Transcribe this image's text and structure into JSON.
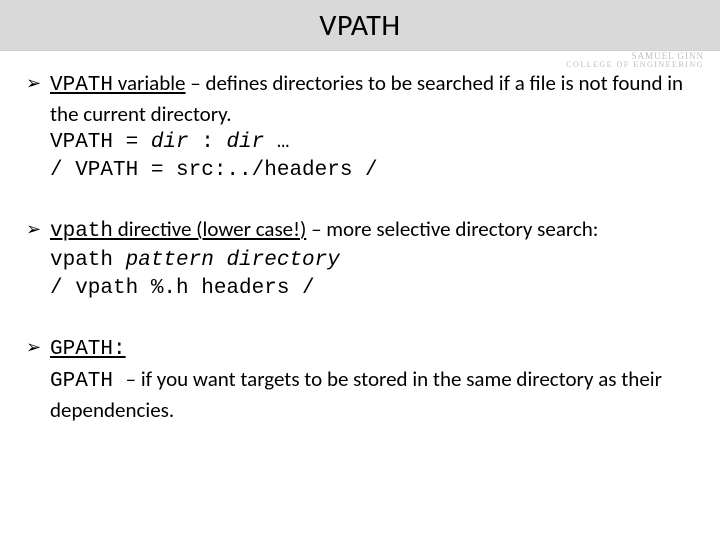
{
  "title": "VPATH",
  "watermark": {
    "line1": "SAMUEL GINN",
    "line2": "COLLEGE OF ENGINEERING"
  },
  "items": [
    {
      "lead_code": "VPATH",
      "lead_text": " variable",
      "desc": " – defines directories to be searched if a file is not found in the current directory.",
      "code1_prefix": "VPATH = ",
      "code1_ital": "dir",
      "code1_mid": " : ",
      "code1_ital2": "dir",
      "code1_suffix": " …",
      "code2": "/ VPATH = src:../headers /"
    },
    {
      "lead_code": "vpath",
      "lead_text": " directive (lower case!)",
      "desc": " – more selective directory search:",
      "code1_prefix": "vpath ",
      "code1_ital": "pattern directory",
      "code1_mid": "",
      "code1_ital2": "",
      "code1_suffix": "",
      "code2": "/ vpath %.h headers /"
    },
    {
      "lead_code": "GPATH:",
      "lead_text": "",
      "desc": "",
      "code1_prefix": "GPATH ",
      "code1_ital": "",
      "code1_mid": "",
      "code1_ital2": "",
      "code1_suffix": "",
      "tail": " – if you want targets to be stored in the same directory as their dependencies.",
      "code2": ""
    }
  ]
}
